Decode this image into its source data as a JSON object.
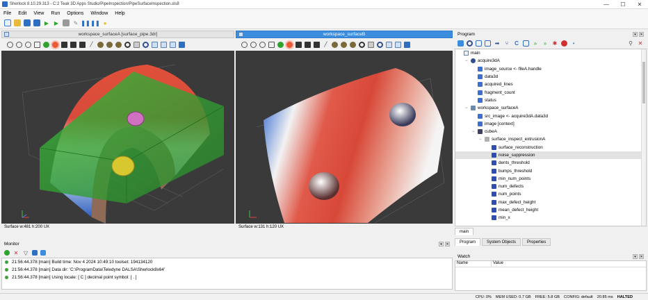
{
  "window": {
    "title": "Sherlock 8.10.29.313 - C:2 Teak 3D Apps Studio/PipeInspection/PipeSurfaceInspection.sls8",
    "controls": [
      "—",
      "☐",
      "✕"
    ]
  },
  "menu": [
    "File",
    "Edit",
    "View",
    "Run",
    "Options",
    "Window",
    "Help"
  ],
  "toolbar_icons": [
    "new-icon",
    "open-icon",
    "save-icon",
    "save-all-icon",
    "run-icon",
    "run-once-icon",
    "stop-icon",
    "edit-icon",
    "pause-icon",
    "pause-icon",
    "bulb-icon"
  ],
  "viewers": [
    {
      "title": "workspace_surfaceA [surface_pipe.3dr]",
      "active": false,
      "status": "Surface w:481 h:200 UX"
    },
    {
      "title": "workspace_surfaceB",
      "active": true,
      "status": "Surface w:131 h:120 UX"
    }
  ],
  "program": {
    "header": "Program",
    "tree": [
      {
        "label": "main",
        "level": 0,
        "expander": "",
        "icon": "doc"
      },
      {
        "label": "acquire3dA",
        "level": 1,
        "expander": "−",
        "icon": "camera"
      },
      {
        "label": "image_source <- fileA.handle",
        "level": 2,
        "expander": "",
        "icon": "var"
      },
      {
        "label": "data3d",
        "level": 2,
        "expander": "",
        "icon": "var"
      },
      {
        "label": "acquired_lines",
        "level": 2,
        "expander": "",
        "icon": "var"
      },
      {
        "label": "fragment_count",
        "level": 2,
        "expander": "",
        "icon": "var"
      },
      {
        "label": "status",
        "level": 2,
        "expander": "",
        "icon": "var"
      },
      {
        "label": "workspace_surfaceA",
        "level": 1,
        "expander": "−",
        "icon": "image"
      },
      {
        "label": "src_image <- acquire3dA.data3d",
        "level": 2,
        "expander": "",
        "icon": "var"
      },
      {
        "label": "image [context]",
        "level": 2,
        "expander": "",
        "icon": "var"
      },
      {
        "label": "cubeA",
        "level": 2,
        "expander": "−",
        "icon": "cube"
      },
      {
        "label": "surface_inspect_extrusionA",
        "level": 3,
        "expander": "−",
        "icon": "tool"
      },
      {
        "label": "surface_reconstruction",
        "level": 4,
        "expander": "",
        "icon": "param"
      },
      {
        "label": "noise_suppression",
        "level": 4,
        "expander": "",
        "icon": "param",
        "selected": true
      },
      {
        "label": "dents_threshold",
        "level": 4,
        "expander": "",
        "icon": "param"
      },
      {
        "label": "bumps_threshold",
        "level": 4,
        "expander": "",
        "icon": "param"
      },
      {
        "label": "min_num_points",
        "level": 4,
        "expander": "",
        "icon": "param"
      },
      {
        "label": "num_defects",
        "level": 4,
        "expander": "",
        "icon": "param"
      },
      {
        "label": "num_points",
        "level": 4,
        "expander": "",
        "icon": "param"
      },
      {
        "label": "max_defect_height",
        "level": 4,
        "expander": "",
        "icon": "param"
      },
      {
        "label": "mean_defect_height",
        "level": 4,
        "expander": "",
        "icon": "param"
      },
      {
        "label": "min_x",
        "level": 4,
        "expander": "",
        "icon": "param"
      }
    ],
    "bottom_tab": "main",
    "tabs": [
      "Program",
      "System Objects",
      "Properties"
    ]
  },
  "watch": {
    "header": "Watch",
    "columns": [
      "Name",
      "Value"
    ]
  },
  "monitor": {
    "header": "Monitor",
    "lines": [
      "21:56:44.378 [main] Build time: Nov  4 2024 10:49:10 toolset: 194134120",
      "21:56:44.378 [main] Data dir: 'C:\\ProgramData\\Teledyne DALSA\\Sherlock8x64'",
      "21:56:44.378 [main] Using locale: [ C ] decimal point symbol: [ . ]"
    ]
  },
  "status": {
    "cpu": "CPU: 0%",
    "mem": "MEM USED: 0.7 GB",
    "free": "FREE: 5.8 GB",
    "config": "CONFIG: default",
    "time": "20.85 ms",
    "state": "HALTED"
  },
  "colors": {
    "accent": "#3c8dde",
    "viewer_bg": "#3a3a3a",
    "ok": "#3aa335"
  }
}
